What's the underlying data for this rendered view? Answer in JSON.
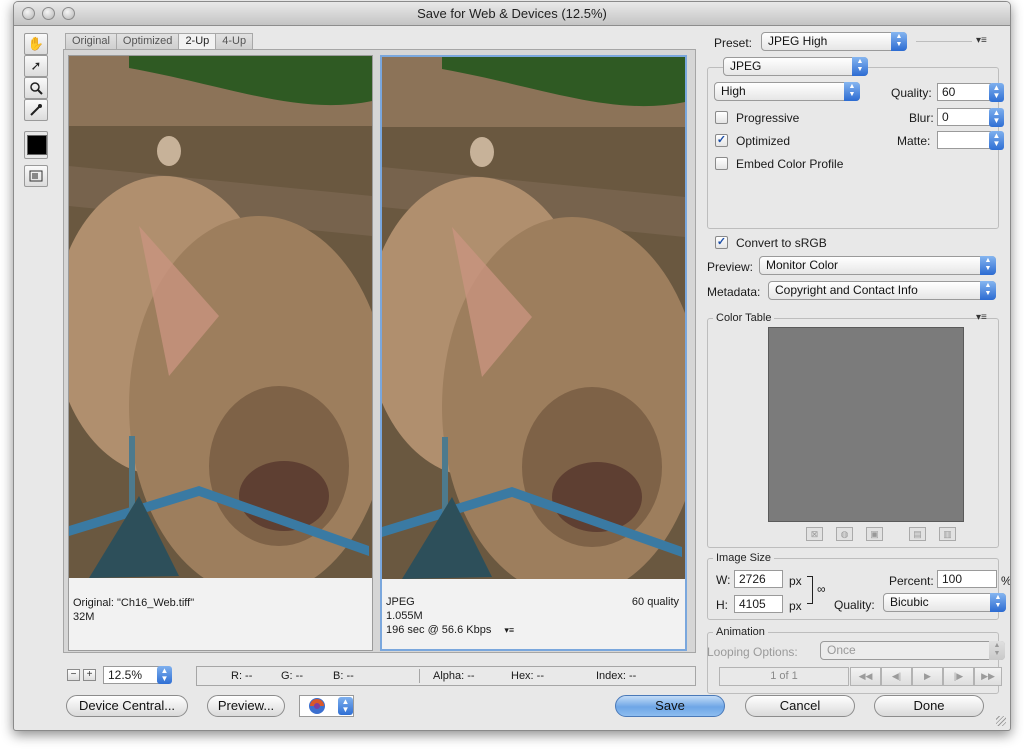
{
  "window": {
    "title": "Save for Web & Devices (12.5%)"
  },
  "tabs": [
    "Original",
    "Optimized",
    "2-Up",
    "4-Up"
  ],
  "left_pane": {
    "line1": "Original: \"Ch16_Web.tiff\"",
    "line2": "32M"
  },
  "right_pane": {
    "format": "JPEG",
    "quality_note": "60 quality",
    "size": "1.055M",
    "time": "196 sec @ 56.6 Kbps"
  },
  "bottom": {
    "zoom": "12.5%",
    "r": "R: --",
    "g": "G: --",
    "b": "B: --",
    "alpha": "Alpha: --",
    "hex": "Hex: --",
    "index": "Index: --"
  },
  "buttons": {
    "device_central": "Device Central...",
    "preview": "Preview...",
    "save": "Save",
    "cancel": "Cancel",
    "done": "Done"
  },
  "settings": {
    "preset_label": "Preset:",
    "preset_value": "JPEG High",
    "format_value": "JPEG",
    "quality_preset": "High",
    "quality_label": "Quality:",
    "quality_value": "60",
    "blur_label": "Blur:",
    "blur_value": "0",
    "matte_label": "Matte:",
    "progressive": {
      "label": "Progressive",
      "checked": false
    },
    "optimized": {
      "label": "Optimized",
      "checked": true
    },
    "embed_profile": {
      "label": "Embed Color Profile",
      "checked": false
    },
    "convert_srgb": {
      "label": "Convert to sRGB",
      "checked": true
    },
    "preview_label": "Preview:",
    "preview_value": "Monitor Color",
    "metadata_label": "Metadata:",
    "metadata_value": "Copyright and Contact Info"
  },
  "color_table": {
    "title": "Color Table"
  },
  "image_size": {
    "title": "Image Size",
    "w_label": "W:",
    "w_value": "2726",
    "w_unit": "px",
    "h_label": "H:",
    "h_value": "4105",
    "h_unit": "px",
    "percent_label": "Percent:",
    "percent_value": "100",
    "percent_unit": "%",
    "quality_label": "Quality:",
    "quality_value": "Bicubic"
  },
  "animation": {
    "title": "Animation",
    "looping_label": "Looping Options:",
    "looping_value": "Once",
    "frame_counter": "1 of 1"
  }
}
